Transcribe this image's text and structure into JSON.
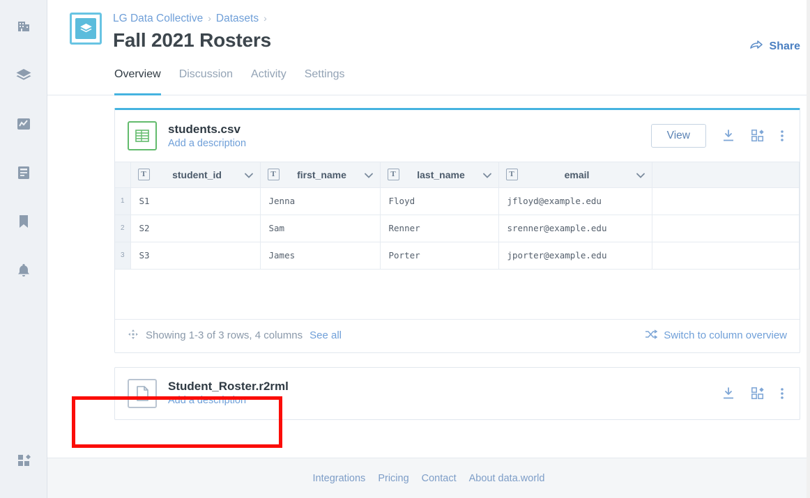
{
  "sidebar": {
    "items": [
      {
        "name": "organization",
        "icon": "building-icon"
      },
      {
        "name": "datasets",
        "icon": "layers-icon"
      },
      {
        "name": "insights",
        "icon": "chart-icon"
      },
      {
        "name": "projects",
        "icon": "document-icon"
      },
      {
        "name": "bookmarks",
        "icon": "bookmark-icon"
      },
      {
        "name": "notifications",
        "icon": "bell-icon"
      }
    ],
    "bottom": {
      "name": "integrations",
      "icon": "apps-grid-icon"
    }
  },
  "header": {
    "breadcrumb": [
      {
        "label": "LG Data Collective",
        "type": "link"
      },
      {
        "label": "Datasets",
        "type": "link"
      }
    ],
    "separator": "›",
    "title": "Fall 2021 Rosters",
    "dataset_icon": "layers-icon",
    "share_label": "Share",
    "share_icon": "share-arrow-icon"
  },
  "tabs": [
    {
      "label": "Overview",
      "active": true
    },
    {
      "label": "Discussion",
      "active": false
    },
    {
      "label": "Activity",
      "active": false
    },
    {
      "label": "Settings",
      "active": false
    }
  ],
  "files": [
    {
      "name": "students.csv",
      "description": "Add a description",
      "icon": "csv-table-icon",
      "view_label": "View",
      "actions": [
        "download-icon",
        "apps-grid-icon",
        "kebab-menu-icon"
      ],
      "has_table": true
    },
    {
      "name": "Student_Roster.r2rml",
      "description": "Add a description",
      "icon": "file-document-icon",
      "actions": [
        "download-icon",
        "apps-grid-icon",
        "kebab-menu-icon"
      ],
      "has_table": false,
      "highlighted": true
    }
  ],
  "table": {
    "type_badge": "T",
    "columns": [
      "student_id",
      "first_name",
      "last_name",
      "email"
    ],
    "rows": [
      {
        "num": "1",
        "cells": [
          "S1",
          "Jenna",
          "Floyd",
          "jfloyd@example.edu"
        ]
      },
      {
        "num": "2",
        "cells": [
          "S2",
          "Sam",
          "Renner",
          "srenner@example.edu"
        ]
      },
      {
        "num": "3",
        "cells": [
          "S3",
          "James",
          "Porter",
          "jporter@example.edu"
        ]
      }
    ],
    "footer": {
      "status": "Showing 1-3 of 3 rows, 4 columns",
      "see_all": "See all",
      "switch_label": "Switch to column overview",
      "resize_icon": "resize-arrows-icon",
      "switch_icon": "shuffle-icon"
    }
  },
  "page_footer": {
    "links": [
      "Integrations",
      "Pricing",
      "Contact",
      "About data.world"
    ]
  },
  "colors": {
    "accent_blue": "#45b3e0",
    "link_blue": "#6f9fd8",
    "green": "#62bb6c",
    "annotation_red": "#fb0d08",
    "sidebar_bg": "#eef1f5"
  }
}
